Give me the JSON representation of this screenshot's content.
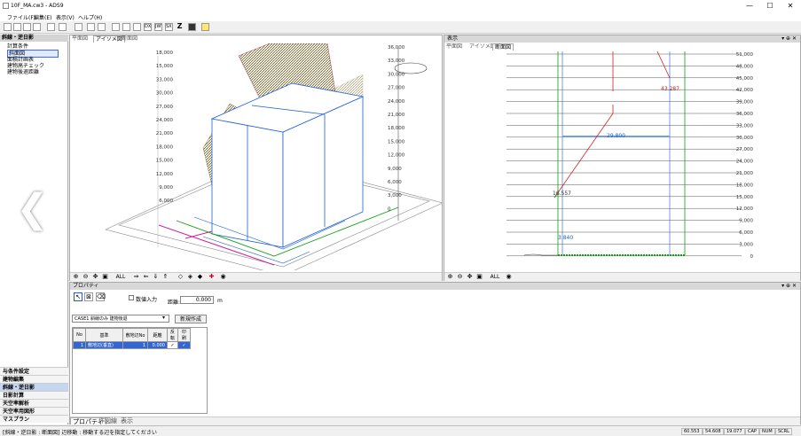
{
  "window": {
    "title": "10F_MA.cw3 - ADS9",
    "min": "—",
    "max": "☐",
    "close": "✕"
  },
  "menu": [
    "ファイル(F)",
    "編集(E)",
    "表示(V)",
    "ヘルプ(H)"
  ],
  "toolbar": {
    "buttons": [
      "new-doc",
      "open",
      "save",
      "save-as",
      "copy",
      "undo",
      "print",
      "print-preview",
      "zoom-window",
      "view1",
      "view2",
      "view3",
      "view4",
      "DXF",
      "JWW",
      "SXF",
      "Z",
      "highlight",
      "help"
    ]
  },
  "left": {
    "header": "斜線・逆日影",
    "tree": [
      "計算条件",
      "斜面図",
      "面積計画表",
      "建物高チェック",
      "建物後退距離"
    ],
    "selected": 1,
    "bottom": [
      "斜線・逆日影",
      "日影計算",
      "天空率解析",
      "天空率用図形",
      "マスプラン",
      "与条件設定",
      "建物編集"
    ],
    "active_bottom": "斜線・逆日影"
  },
  "pane3d": {
    "tabs": [
      "平面図",
      "アイソメ図",
      "断面図"
    ],
    "active": 1,
    "zlabels": [
      "36,000",
      "33,000",
      "30,000",
      "27,000",
      "24,000",
      "21,000",
      "18,000",
      "15,000",
      "12,000",
      "9,000",
      "6,000",
      "3,000",
      "0"
    ],
    "llabels": [
      "18,000",
      "15,000",
      "33,000",
      "30,000",
      "27,000",
      "24,000",
      "21,000",
      "18,000",
      "15,000",
      "12,000",
      "9,000",
      "6,000"
    ],
    "toolbar": [
      "zoom-in",
      "zoom-out",
      "pan",
      "fit",
      "ALL",
      "rotate-left",
      "rotate-right",
      "rotate-up",
      "rotate-down",
      "view-a",
      "view-b",
      "view-c",
      "view-d",
      "eye"
    ]
  },
  "pane2d": {
    "title": "表示",
    "tabs": [
      "平面図",
      "アイソメ図",
      "断面図"
    ],
    "active": 2,
    "ylabels": [
      "51,000",
      "48,000",
      "45,000",
      "42,000",
      "39,000",
      "36,000",
      "33,000",
      "30,000",
      "27,000",
      "24,000",
      "21,000",
      "18,000",
      "15,000",
      "12,000",
      "9,000",
      "6,000",
      "3,000",
      "0"
    ],
    "notes": {
      "a": "43.287",
      "b": "29.800",
      "c": "16.557",
      "d": "3.840"
    },
    "toolbar": [
      "zoom-in",
      "zoom-out",
      "pan",
      "fit",
      "ALL",
      "eye"
    ]
  },
  "props": {
    "title": "プロパティ",
    "checkbox_label": "数値入力",
    "distance_label": "距離:",
    "distance_value": "0.000",
    "distance_unit": "m",
    "case_select": "CASE1 斜線のみ 建物後退",
    "create_button": "新規作成",
    "headers": [
      "No",
      "基準",
      "敷地辺No",
      "距離",
      "反転",
      "印刷"
    ],
    "rows": [
      {
        "no": "1",
        "base": "敷地辺(垂直)",
        "edge": "1",
        "dist": "0.000",
        "rev": "✓",
        "print": "✓"
      }
    ],
    "bottom_tabs": [
      "プロパティ",
      "作図線",
      "表示"
    ]
  },
  "status": {
    "message": "[斜線・逆日影 : 断面図] 辺移動 : 移動する辺を指定してください",
    "x": "60.553",
    "y": "54.608",
    "z": "19.077",
    "caps": "CAP",
    "num": "NUM",
    "scrl": "SCRL"
  }
}
